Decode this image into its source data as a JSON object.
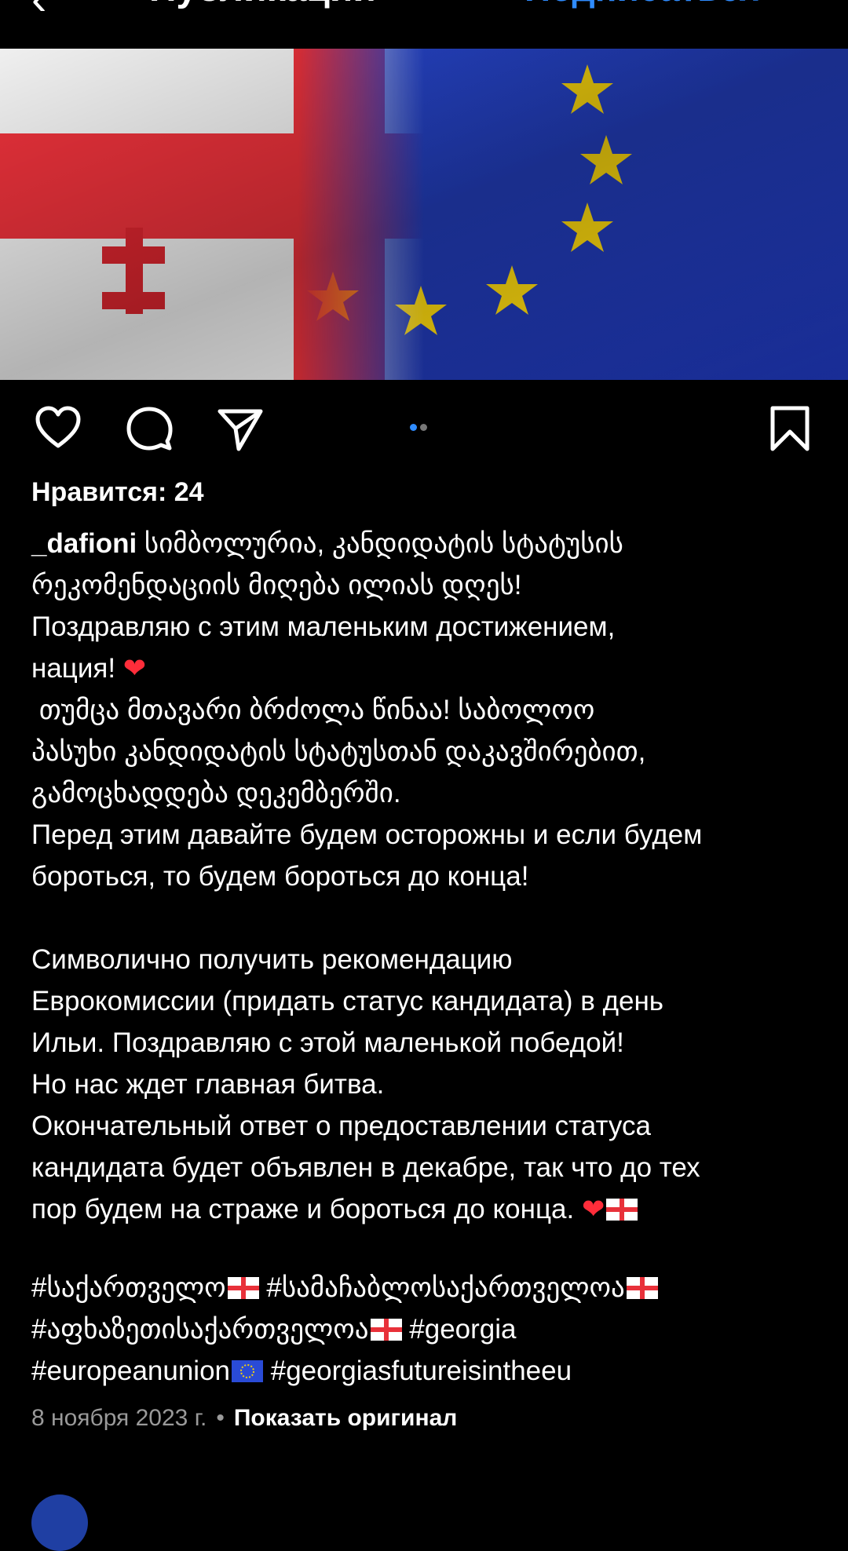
{
  "header": {
    "back_icon": "‹",
    "title": "Публикации",
    "follow_label": "Подписаться",
    "accent_color": "#2f8cff"
  },
  "post": {
    "image_alt": "georgia-eu-flags-image",
    "likes_text": "Нравится: 24",
    "username": "_dafioni",
    "caption_lines": [
      " სიმბოლურია, კანდიდატის სტატუსის",
      "რეკომენდაციის მიღება ილიას დღეს!",
      "Поздравляю с этим маленьким достижением,",
      "нация! ",
      " თუმცა მთავარი ბრძოლა წინაა! საბოლოო",
      "პასუხი კანდიდატის სტატუსთან დაკავშირებით,",
      "გამოცხადდება დეკემბერში.",
      "Перед этим давайте будем осторожны и если будем",
      "бороться, то будем бороться до конца!",
      "",
      "Символично получить рекомендацию",
      "Еврокомиссии (придать статус кандидата) в день",
      "Ильи. Поздравляю с этой маленькой победой!",
      "Но нас ждет главная битва.",
      "Окончательный ответ о предоставлении статуса",
      "кандидата будет объявлен в декабре, так что до тех",
      "пор будем на страже и бороться до конца. "
    ],
    "heart_emoji": "❤",
    "hashtags": [
      " #საქართველო",
      "#სამაჩაბლოსაქართველოა",
      "#აფხაზეთისაქართველოა",
      "#georgia",
      "#europeanunion",
      "#georgiasfutureisintheeu"
    ],
    "date": "8 ноября 2023 г.",
    "separator": "•",
    "show_original": "Показать оригинал"
  },
  "icons": {
    "like": "heart-outline-icon",
    "comment": "comment-bubble-icon",
    "share": "paper-plane-icon",
    "save": "bookmark-icon"
  },
  "carousel": {
    "count": 2,
    "active": 0,
    "active_color": "#2f8cff",
    "inactive_color": "#777777"
  }
}
